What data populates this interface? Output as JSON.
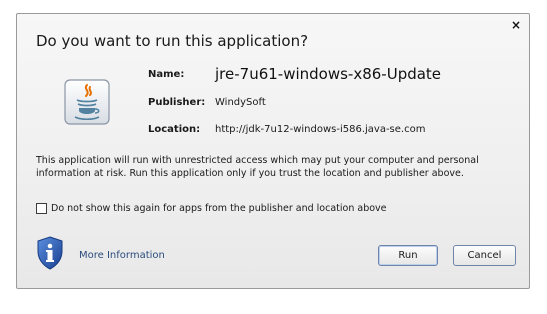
{
  "dialog": {
    "title": "Do you want to run this application?",
    "close_glyph": "×",
    "name_label": "Name:",
    "name_value": "jre-7u61-windows-x86-Update",
    "publisher_label": "Publisher:",
    "publisher_value": "WindySoft",
    "location_label": "Location:",
    "location_value": "http://jdk-7u12-windows-i586.java-se.com",
    "warning_text": "This application will run with unrestricted access which may put your computer and personal information at risk. Run this application only if you trust the location and publisher above.",
    "checkbox_label": "Do not show this again for apps from the publisher and location above",
    "checkbox_checked": false,
    "more_info_label": "More Information",
    "run_label": "Run",
    "cancel_label": "Cancel"
  },
  "icons": {
    "app": "java-icon",
    "info": "shield-info-icon",
    "close": "close-icon"
  },
  "colors": {
    "java_orange": "#e76f00",
    "java_blue": "#5382a1",
    "shield_blue": "#1f4fa8",
    "link_blue": "#2c4c7c"
  }
}
